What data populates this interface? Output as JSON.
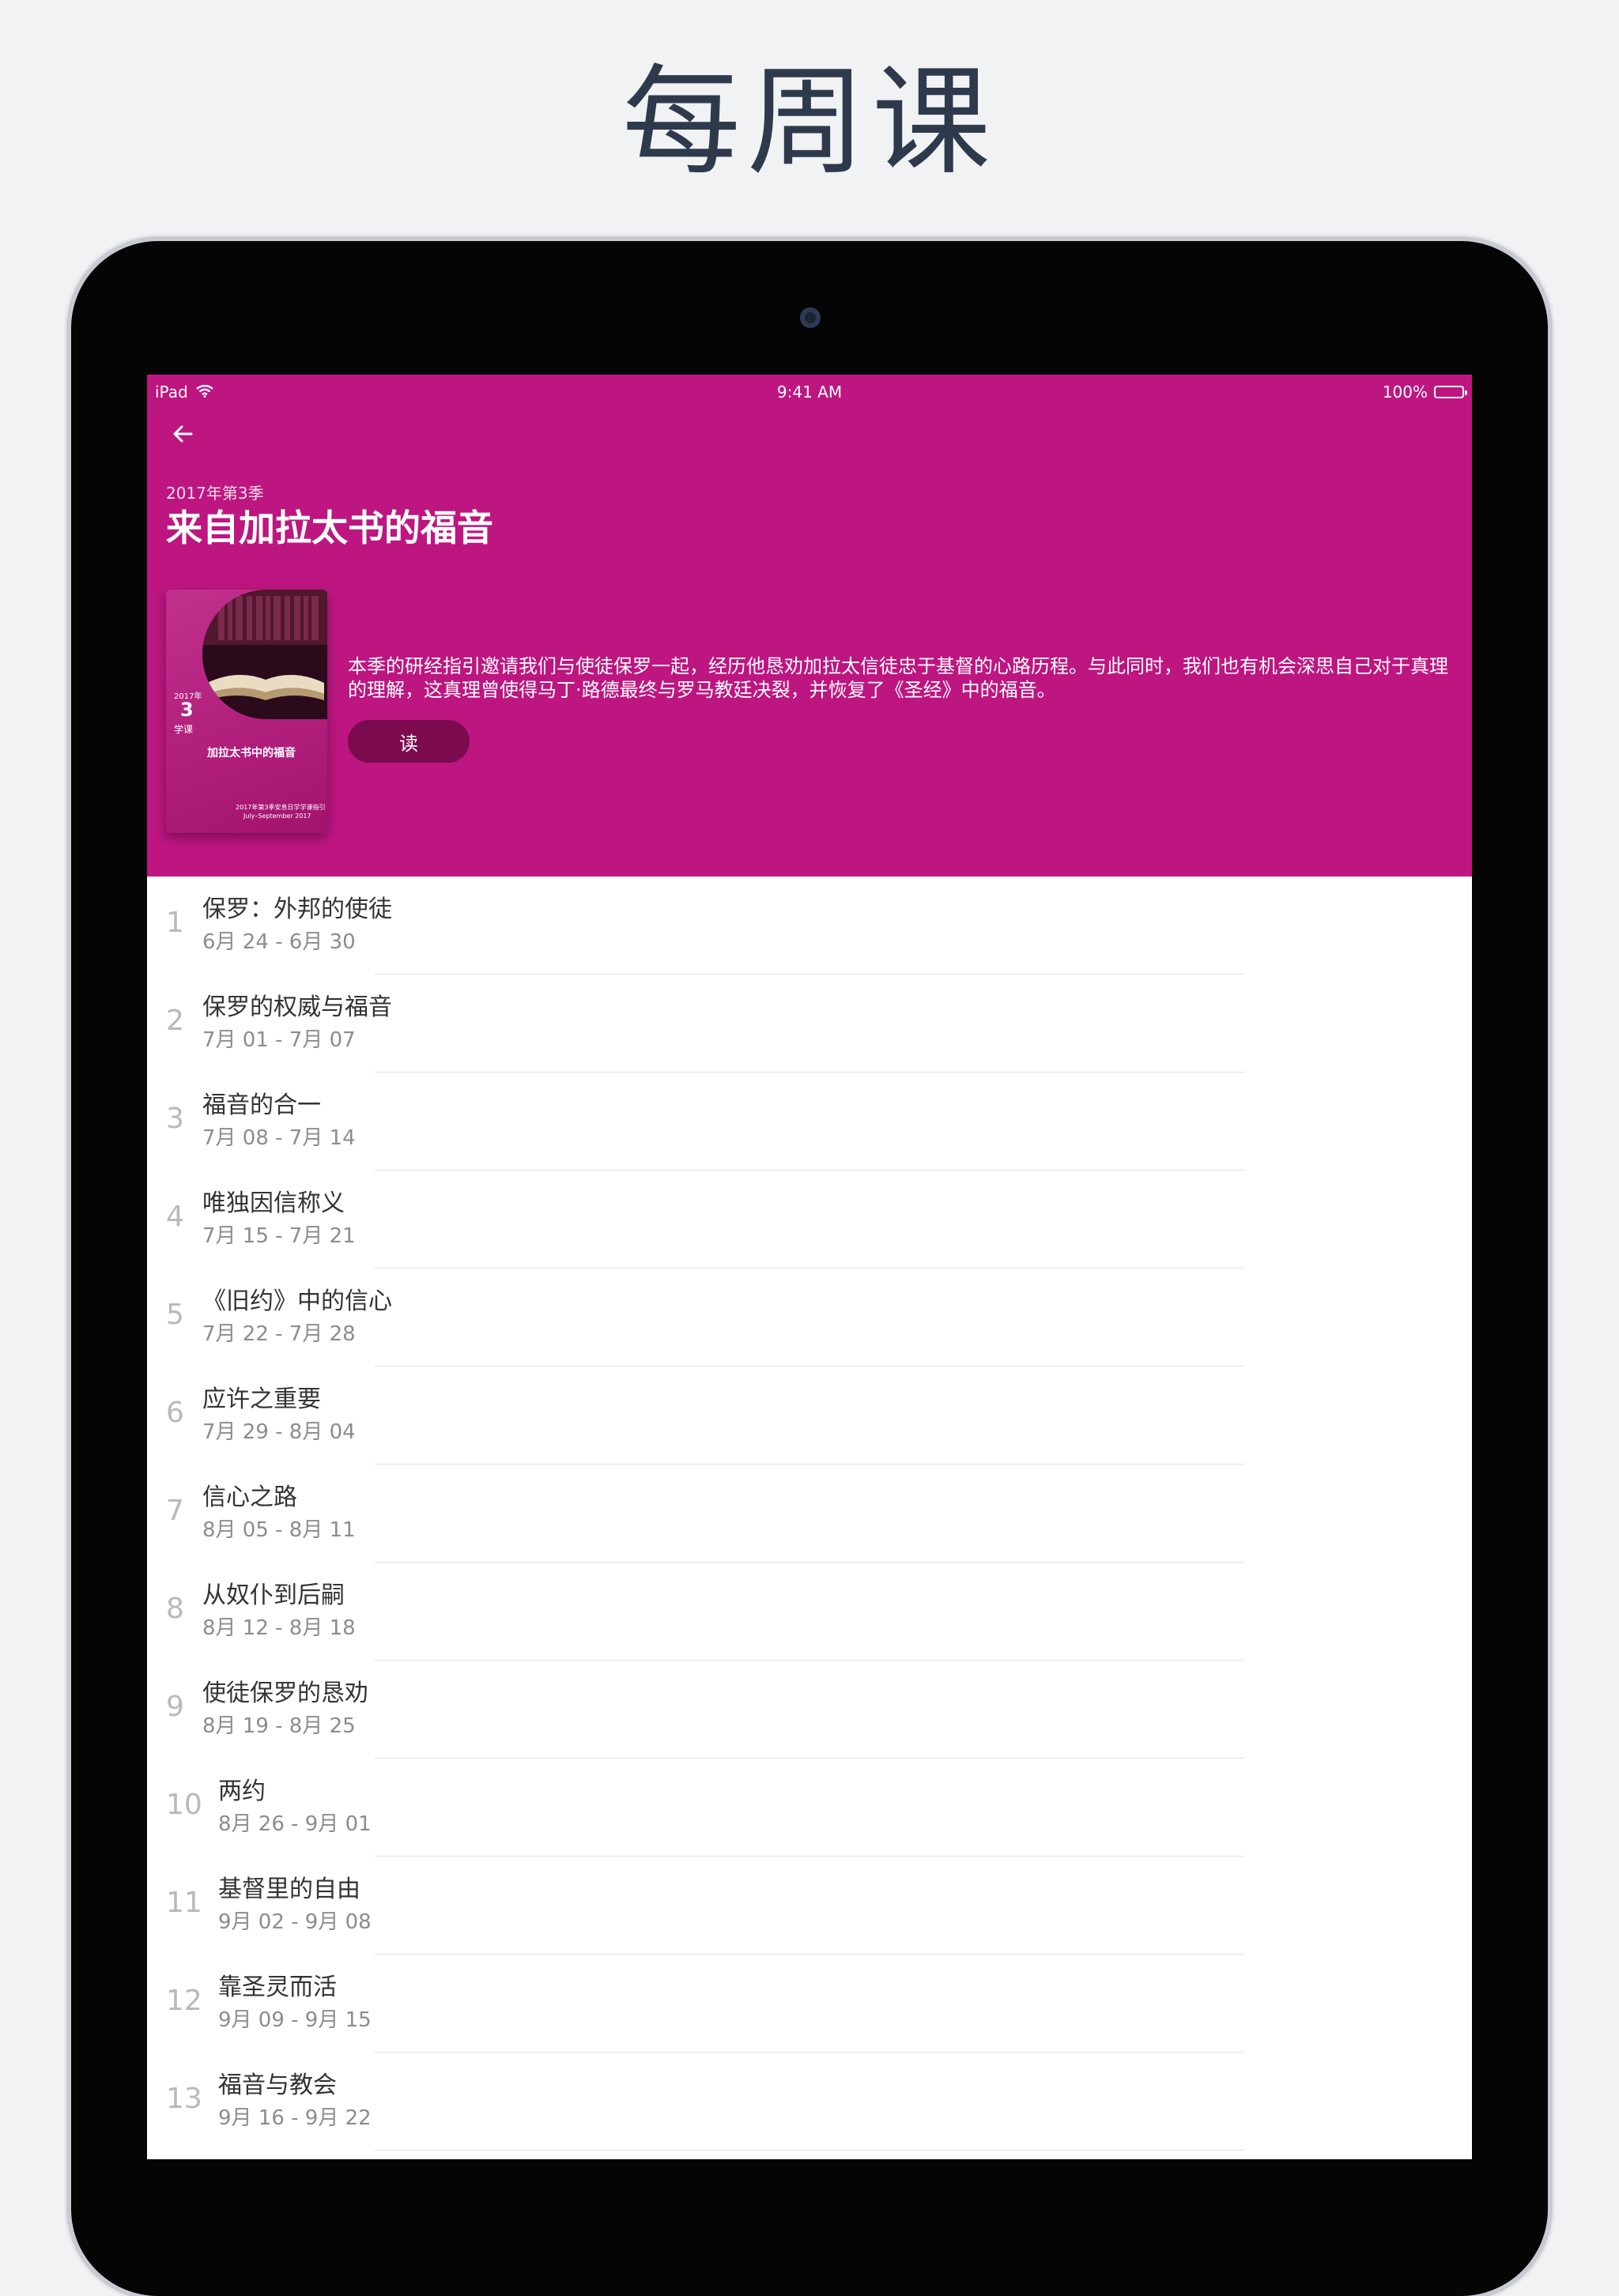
{
  "headline": "每周课",
  "status_bar": {
    "device": "iPad",
    "time": "9:41 AM",
    "battery": "100%"
  },
  "quarterly": {
    "label": "2017年第3季",
    "title": "来自加拉太书的福音",
    "description": "本季的研经指引邀请我们与使徒保罗一起，经历他恳劝加拉太信徒忠于基督的心路历程。与此同时，我们也有机会深思自己对于真理的理解，这真理曾使得马丁·路德最终与罗马教廷决裂，并恢复了《圣经》中的福音。",
    "read_label": "读",
    "cover": {
      "year": "2017年",
      "quarter": "3",
      "word": "学课",
      "title": "加拉太书中的福音",
      "footer": "2017年第3季安息日学学课指引",
      "footer2": "July–September 2017"
    }
  },
  "lessons": [
    {
      "num": "1",
      "title": "保罗：外邦的使徒",
      "dates": "6月 24 - 6月 30"
    },
    {
      "num": "2",
      "title": "保罗的权威与福音",
      "dates": "7月 01 - 7月 07"
    },
    {
      "num": "3",
      "title": "福音的合一",
      "dates": "7月 08 - 7月 14"
    },
    {
      "num": "4",
      "title": "唯独因信称义",
      "dates": "7月 15 - 7月 21"
    },
    {
      "num": "5",
      "title": "《旧约》中的信心",
      "dates": "7月 22 - 7月 28"
    },
    {
      "num": "6",
      "title": "应许之重要",
      "dates": "7月 29 - 8月 04"
    },
    {
      "num": "7",
      "title": "信心之路",
      "dates": "8月 05 - 8月 11"
    },
    {
      "num": "8",
      "title": "从奴仆到后嗣",
      "dates": "8月 12 - 8月 18"
    },
    {
      "num": "9",
      "title": "使徒保罗的恳劝",
      "dates": "8月 19 - 8月 25"
    },
    {
      "num": "10",
      "title": "两约",
      "dates": "8月 26 - 9月 01"
    },
    {
      "num": "11",
      "title": "基督里的自由",
      "dates": "9月 02 - 9月 08"
    },
    {
      "num": "12",
      "title": "靠圣灵而活",
      "dates": "9月 09 - 9月 15"
    },
    {
      "num": "13",
      "title": "福音与教会",
      "dates": "9月 16 - 9月 22"
    }
  ],
  "colors": {
    "accent": "#bd1681",
    "button": "#7c0a4f"
  },
  "icons": {
    "back": "arrow-left-icon",
    "wifi": "wifi-icon",
    "battery": "battery-icon"
  }
}
